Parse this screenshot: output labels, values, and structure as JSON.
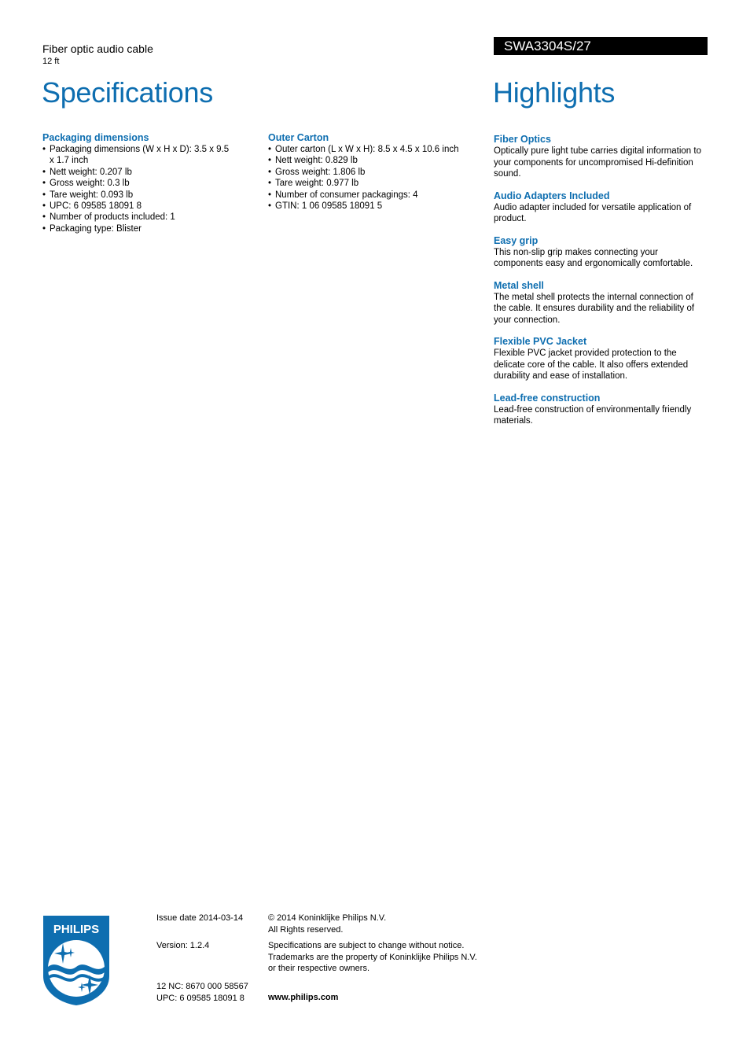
{
  "header": {
    "product_title": "Fiber optic audio cable",
    "product_subtitle": "12 ft",
    "model": "SWA3304S/27",
    "specifications_heading": "Specifications",
    "highlights_heading": "Highlights"
  },
  "colors": {
    "accent": "#0e6eb0",
    "model_bar_bg": "#000000"
  },
  "specifications": {
    "packaging_dimensions": {
      "title": "Packaging dimensions",
      "items": [
        "Packaging dimensions (W x H x D): 3.5 x 9.5 x 1.7 inch",
        "Nett weight: 0.207 lb",
        "Gross weight: 0.3 lb",
        "Tare weight: 0.093 lb",
        "UPC: 6 09585 18091 8",
        "Number of products included: 1",
        "Packaging type: Blister"
      ]
    },
    "outer_carton": {
      "title": "Outer Carton",
      "items": [
        "Outer carton (L x W x H): 8.5 x 4.5 x 10.6 inch",
        "Nett weight: 0.829 lb",
        "Gross weight: 1.806 lb",
        "Tare weight: 0.977 lb",
        "Number of consumer packagings: 4",
        "GTIN: 1 06 09585 18091 5"
      ]
    }
  },
  "highlights": [
    {
      "title": "Fiber Optics",
      "text": "Optically pure light tube carries digital information to your components for uncompromised Hi-definition sound."
    },
    {
      "title": "Audio Adapters Included",
      "text": "Audio adapter included for versatile application of product."
    },
    {
      "title": "Easy grip",
      "text": "This non-slip grip makes connecting your components easy and ergonomically comfortable."
    },
    {
      "title": "Metal shell",
      "text": "The metal shell protects the internal connection of the cable. It ensures durability and the reliability of your connection."
    },
    {
      "title": "Flexible PVC Jacket",
      "text": "Flexible PVC jacket provided protection to the delicate core of the cable. It also offers extended durability and ease of installation."
    },
    {
      "title": "Lead-free construction",
      "text": "Lead-free construction of environmentally friendly materials."
    }
  ],
  "footer": {
    "logo_text": "PHILIPS",
    "issue_date": "Issue date 2014-03-14",
    "version": "Version: 1.2.4",
    "nc": "12 NC: 8670 000 58567",
    "upc": "UPC: 6 09585 18091 8",
    "copyright_line1": "© 2014 Koninklijke Philips N.V.",
    "copyright_line2": "All Rights reserved.",
    "disclaimer_line1": "Specifications are subject to change without notice.",
    "disclaimer_line2": "Trademarks are the property of Koninklijke Philips N.V.",
    "disclaimer_line3": "or their respective owners.",
    "website": "www.philips.com"
  }
}
